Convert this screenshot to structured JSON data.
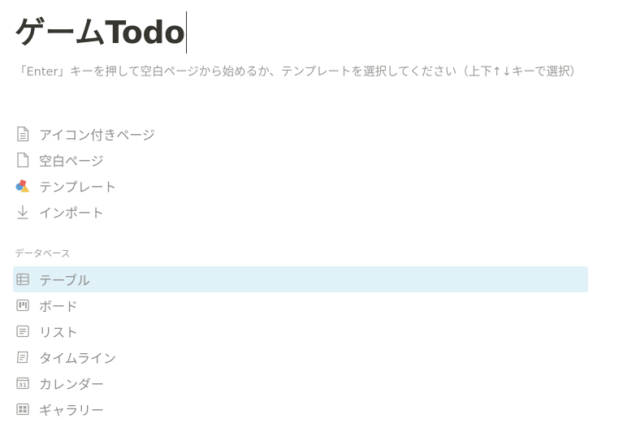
{
  "page": {
    "title": "ゲームTodo",
    "hint": "「Enter」キーを押して空白ページから始めるか、テンプレートを選択してください（上下↑↓キーで選択）"
  },
  "page_options": [
    {
      "label": "アイコン付きページ",
      "icon": "page-with-icon"
    },
    {
      "label": "空白ページ",
      "icon": "empty-page"
    },
    {
      "label": "テンプレート",
      "icon": "template"
    },
    {
      "label": "インポート",
      "icon": "import-arrow"
    }
  ],
  "database": {
    "heading": "データベース",
    "items": [
      {
        "label": "テーブル",
        "icon": "table",
        "selected": true
      },
      {
        "label": "ボード",
        "icon": "board",
        "selected": false
      },
      {
        "label": "リスト",
        "icon": "list",
        "selected": false
      },
      {
        "label": "タイムライン",
        "icon": "timeline",
        "selected": false
      },
      {
        "label": "カレンダー",
        "icon": "calendar",
        "selected": false
      },
      {
        "label": "ギャラリー",
        "icon": "gallery",
        "selected": false
      }
    ]
  },
  "colors": {
    "selected_bg": "#e0f1f8",
    "icon_gray": "#a3a29f",
    "template_red": "#e9615a",
    "template_blue": "#5a9fd4",
    "template_yellow": "#f2c14e"
  }
}
